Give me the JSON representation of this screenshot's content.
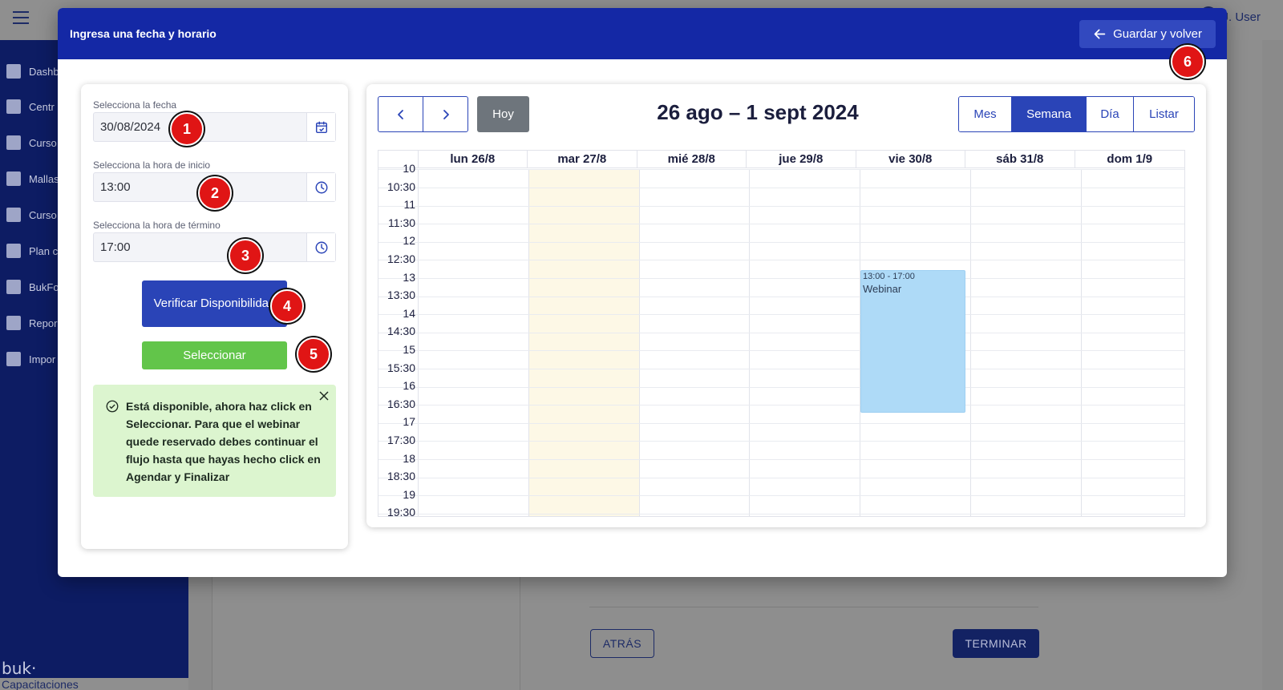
{
  "background": {
    "user_name": "J. User",
    "sidebar_items": [
      "Dashb",
      "Centr",
      "Curso",
      "Mallas",
      "Curso",
      "Plan c",
      "BukFo",
      "Repor",
      "Impor"
    ],
    "logo_text": "buk·",
    "logo_sub": "Capacitaciones",
    "back_label": "ATRÁS",
    "finish_label": "TERMINAR"
  },
  "modal": {
    "title": "Ingresa una fecha y horario",
    "save_label": "Guardar y volver"
  },
  "form": {
    "date_label": "Selecciona la fecha",
    "date_value": "30/08/2024",
    "start_label": "Selecciona la hora de inicio",
    "start_value": "13:00",
    "end_label": "Selecciona la hora de término",
    "end_value": "17:00",
    "verify_label": "Verificar Disponibilidad",
    "select_label": "Seleccionar",
    "alert_part1": "Está disponible, ahora haz click en ",
    "alert_bold1": "Seleccionar",
    "alert_part2": ". Para que el webinar quede reservado debes continuar el flujo hasta que hayas hecho click en ",
    "alert_bold2": "Agendar y Finalizar"
  },
  "calendar": {
    "today_label": "Hoy",
    "title": "26 ago – 1 sept 2024",
    "views": [
      "Mes",
      "Semana",
      "Día",
      "Listar"
    ],
    "active_view": "Semana",
    "days": [
      "lun 26/8",
      "mar 27/8",
      "mié 28/8",
      "jue 29/8",
      "vie 30/8",
      "sáb 31/8",
      "dom 1/9"
    ],
    "today_column": "mar 27/8",
    "time_slots": [
      "10",
      "10:30",
      "11",
      "11:30",
      "12",
      "12:30",
      "13",
      "13:30",
      "14",
      "14:30",
      "15",
      "15:30",
      "16",
      "16:30",
      "17",
      "17:30",
      "18",
      "18:30",
      "19",
      "19:30"
    ],
    "event": {
      "day": "vie 30/8",
      "time": "13:00 - 17:00",
      "title": "Webinar",
      "color": "#aedaf7"
    }
  },
  "markers": [
    "1",
    "2",
    "3",
    "4",
    "5",
    "6"
  ],
  "colors": {
    "header_blue": "#1428a5",
    "primary": "#2a44b7",
    "success_button": "#62c54a",
    "alert_bg": "#dcf5cf",
    "marker_red": "#e01515"
  }
}
